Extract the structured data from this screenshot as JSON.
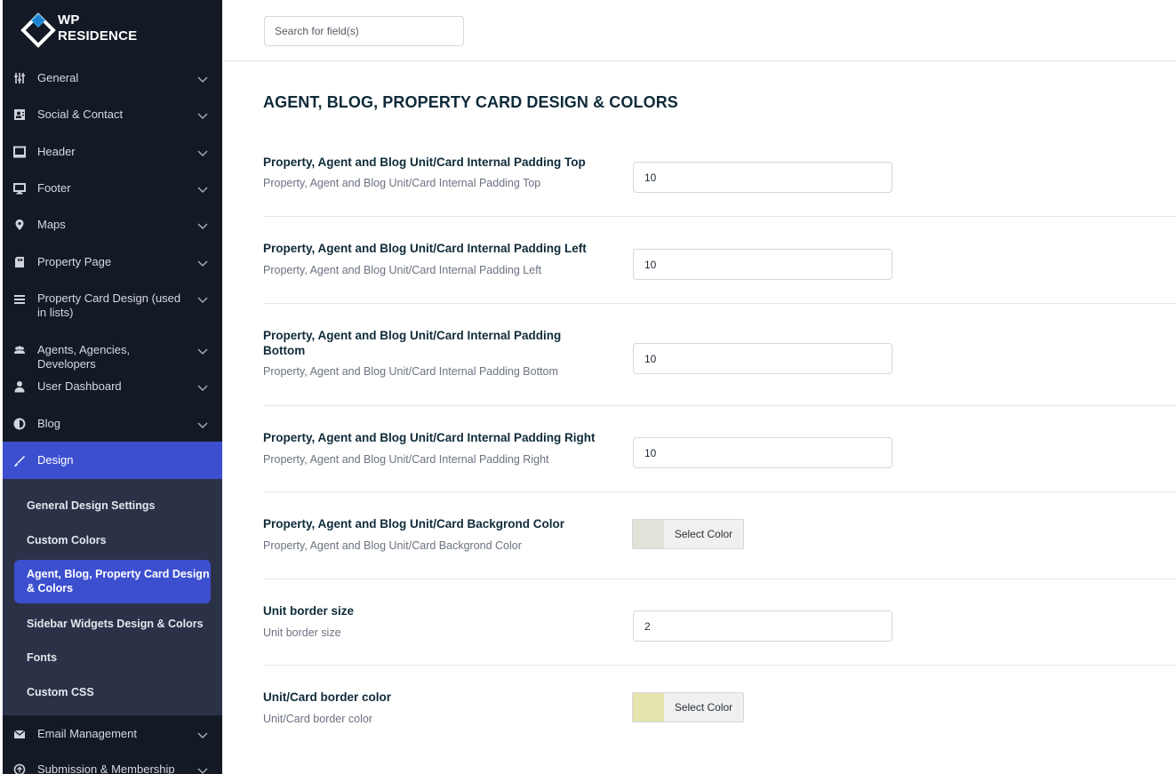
{
  "brand": {
    "line1": "WP",
    "line2": "RESIDENCE"
  },
  "sidebar": {
    "items": [
      {
        "label": "General",
        "icon": "sliders-icon"
      },
      {
        "label": "Social & Contact",
        "icon": "contact-card-icon"
      },
      {
        "label": "Header",
        "icon": "header-icon"
      },
      {
        "label": "Footer",
        "icon": "monitor-icon"
      },
      {
        "label": "Maps",
        "icon": "map-pin-icon"
      },
      {
        "label": "Property Page",
        "icon": "document-icon"
      },
      {
        "label": "Property Card Design (used in lists)",
        "icon": "list-icon"
      },
      {
        "label": "Agents, Agencies, Developers",
        "icon": "users-icon"
      },
      {
        "label": "User Dashboard",
        "icon": "user-icon"
      },
      {
        "label": "Blog",
        "icon": "contrast-icon"
      },
      {
        "label": "Design",
        "icon": "brush-icon"
      },
      {
        "label": "Email Management",
        "icon": "envelope-icon"
      },
      {
        "label": "Submission & Membership",
        "icon": "upload-icon"
      }
    ],
    "submenu": [
      {
        "label": "General Design Settings"
      },
      {
        "label": "Custom Colors"
      },
      {
        "label": "Agent, Blog, Property Card Design & Colors"
      },
      {
        "label": "Sidebar Widgets Design & Colors"
      },
      {
        "label": "Fonts"
      },
      {
        "label": "Custom CSS"
      }
    ]
  },
  "search": {
    "placeholder": "Search for field(s)"
  },
  "main": {
    "title": "AGENT, BLOG, PROPERTY CARD DESIGN & COLORS",
    "fields": [
      {
        "title": "Property, Agent and Blog Unit/Card Internal Padding Top",
        "desc": "Property, Agent and Blog Unit/Card Internal Padding Top",
        "value": "10"
      },
      {
        "title": "Property, Agent and Blog Unit/Card Internal Padding Left",
        "desc": "Property, Agent and Blog Unit/Card Internal Padding Left",
        "value": "10"
      },
      {
        "title": "Property, Agent and Blog Unit/Card Internal Padding Bottom",
        "desc": "Property, Agent and Blog Unit/Card Internal Padding Bottom",
        "value": "10"
      },
      {
        "title": "Property, Agent and Blog Unit/Card Internal Padding Right",
        "desc": "Property, Agent and Blog Unit/Card Internal Padding Right",
        "value": "10"
      },
      {
        "title": "Property, Agent and Blog Unit/Card Backgrond Color",
        "desc": "Property, Agent and Blog Unit/Card Backgrond Color",
        "button": "Select Color",
        "swatch": "#e1e3d8"
      },
      {
        "title": "Unit border size",
        "desc": "Unit border size",
        "value": "2"
      },
      {
        "title": "Unit/Card border color",
        "desc": "Unit/Card border color",
        "button": "Select Color",
        "swatch": "#e5e4ae"
      }
    ]
  },
  "colors": {
    "sidebar_bg": "#141a25",
    "submenu_bg": "#2b3247",
    "accent": "#3c4fcf",
    "heading": "#0f2b3a"
  }
}
